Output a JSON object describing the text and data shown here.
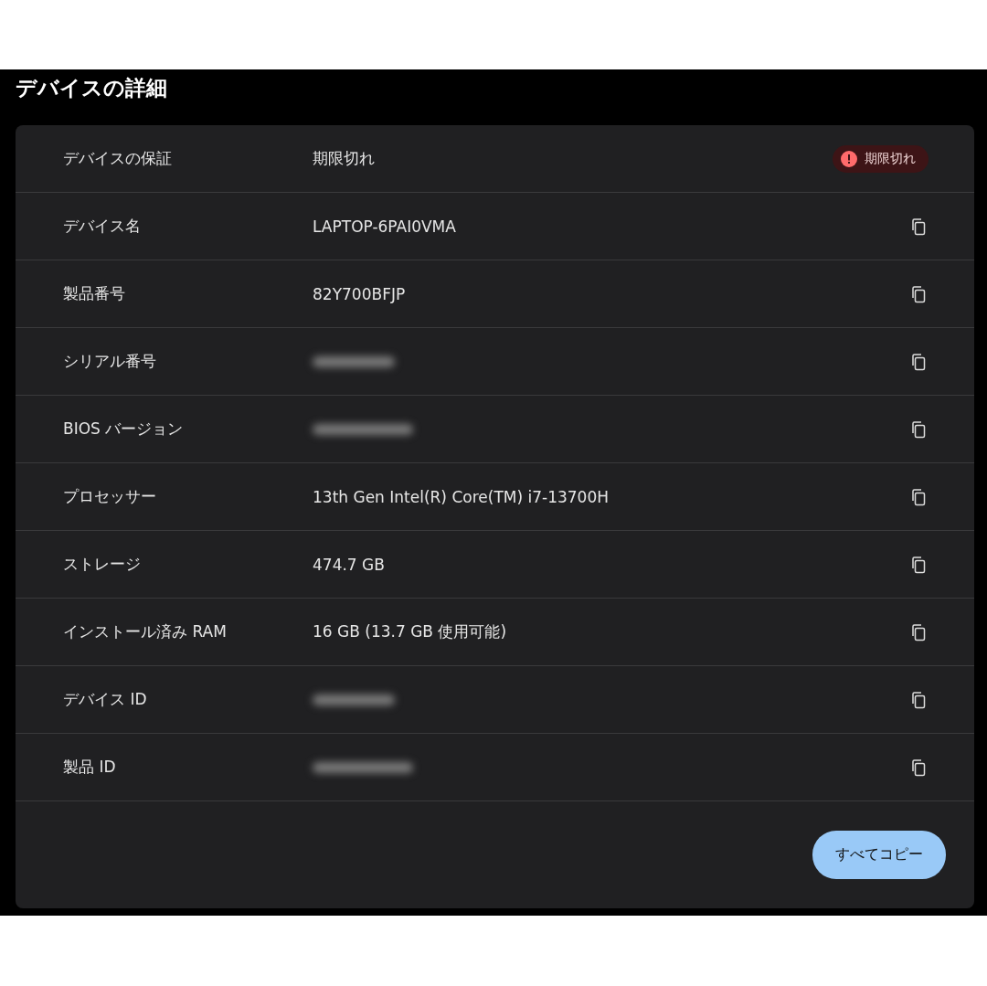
{
  "title": "デバイスの詳細",
  "rows": [
    {
      "label": "デバイスの保証",
      "value": "期限切れ",
      "kind": "status",
      "badge": "期限切れ"
    },
    {
      "label": "デバイス名",
      "value": "LAPTOP-6PAI0VMA",
      "kind": "copy"
    },
    {
      "label": "製品番号",
      "value": "82Y700BFJP",
      "kind": "copy"
    },
    {
      "label": "シリアル番号",
      "kind": "redacted"
    },
    {
      "label": "BIOS バージョン",
      "kind": "redacted"
    },
    {
      "label": "プロセッサー",
      "value": "13th Gen Intel(R) Core(TM) i7-13700H",
      "kind": "copy"
    },
    {
      "label": "ストレージ",
      "value": "474.7 GB",
      "kind": "copy"
    },
    {
      "label": "インストール済み RAM",
      "value": "16 GB (13.7 GB 使用可能)",
      "kind": "copy"
    },
    {
      "label": "デバイス ID",
      "kind": "redacted"
    },
    {
      "label": "製品 ID",
      "kind": "redacted"
    }
  ],
  "button": "すべてコピー"
}
